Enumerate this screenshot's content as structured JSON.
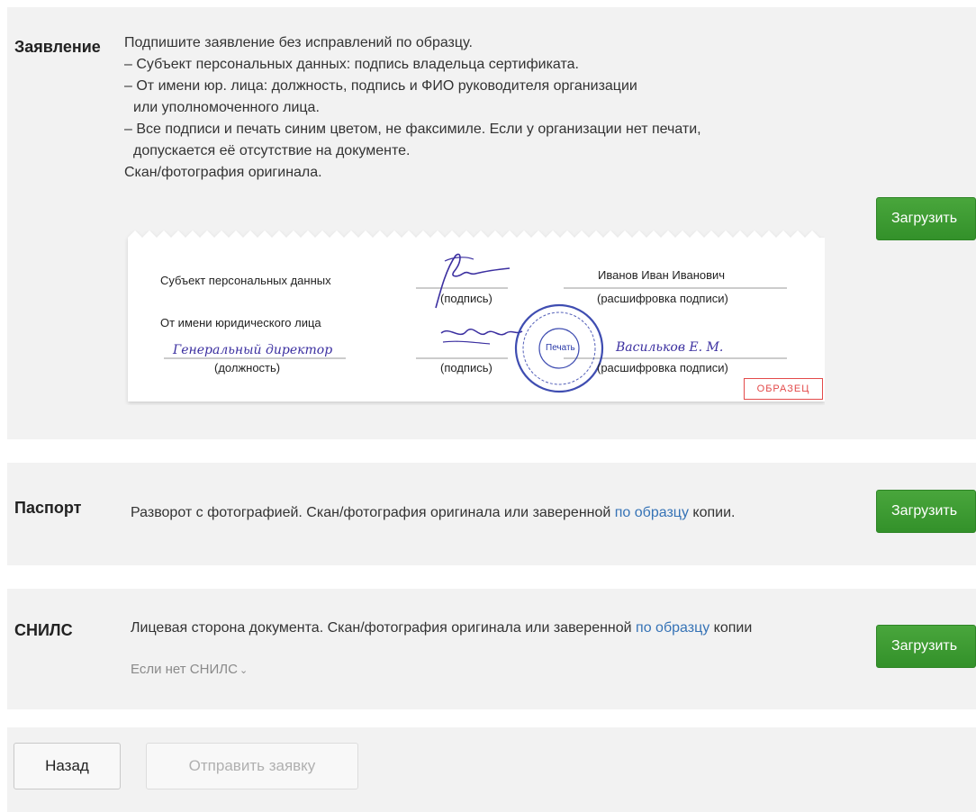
{
  "statement": {
    "title": "Заявление",
    "lines": [
      "Подпишите заявление без исправлений по образцу.",
      "– Субъект персональных данных: подпись владельца сертификата.",
      "– От имени юр. лица: должность, подпись и ФИО руководителя организации",
      "или уполномоченного лица.",
      "– Все подписи и печать синим цветом, не факсимиле. Если у организации нет печати,",
      "допускается её отсутствие на документе.",
      "Скан/фотография оригинала."
    ],
    "upload_label": "Загрузить",
    "sample": {
      "subject_label": "Субъект персональных данных",
      "subject_name": "Иванов Иван Иванович",
      "signature_caption_1": "(подпись)",
      "decode_caption_1": "(расшифровка подписи)",
      "entity_label": "От имени юридического лица",
      "position_value": "Генеральный директор",
      "position_caption": "(должность)",
      "signature_caption_2": "(подпись)",
      "entity_name": "Васильков Е. М.",
      "decode_caption_2": "(расшифровка подписи)",
      "stamp_label": "Печать",
      "badge": "ОБРАЗЕЦ"
    }
  },
  "passport": {
    "title": "Паспорт",
    "desc_before_link": "Разворот с фотографией. Скан/фотография оригинала или заверенной ",
    "link": "по образцу",
    "desc_after_link": " копии.",
    "upload_label": "Загрузить"
  },
  "snils": {
    "title": "СНИЛС",
    "desc_before_link": "Лицевая сторона документа. Скан/фотография оригинала или заверенной ",
    "link": "по образцу",
    "desc_after_link": " копии",
    "toggle": "Если нет СНИЛС",
    "upload_label": "Загрузить"
  },
  "footer": {
    "back_label": "Назад",
    "submit_label": "Отправить заявку"
  },
  "colors": {
    "upload_green": "#3a9a30",
    "link_blue": "#3673b6",
    "panel_gray": "#f2f2f2",
    "signature_blue": "#3b2fa0",
    "badge_red": "#e34a4a"
  }
}
